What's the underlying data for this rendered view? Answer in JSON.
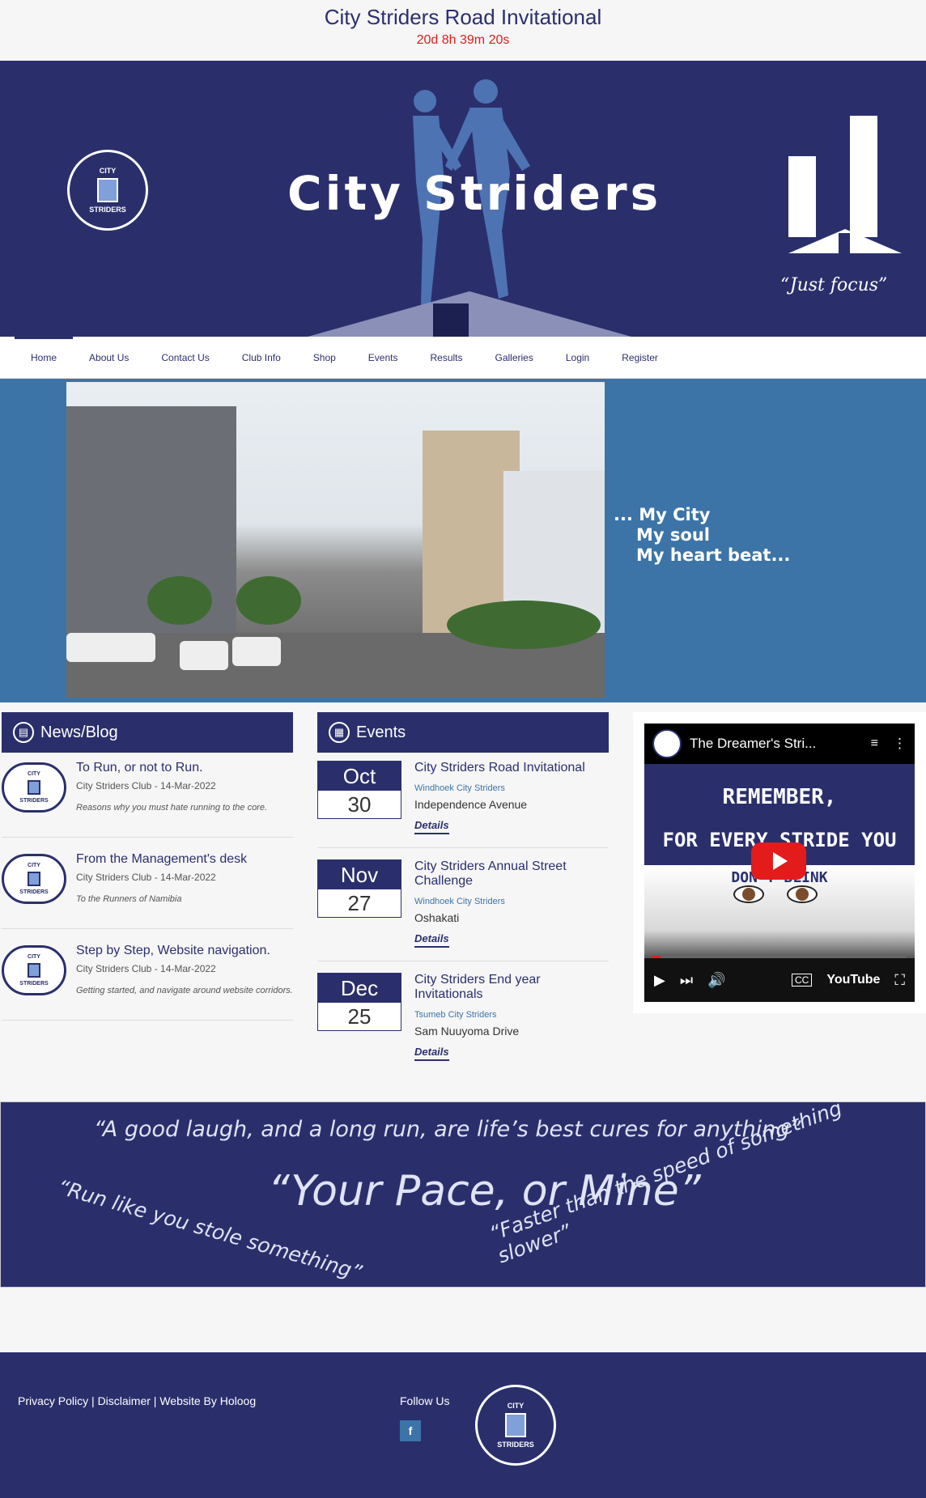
{
  "header": {
    "title": "City Striders Road Invitational",
    "countdown": "20d 8h 39m 20s"
  },
  "hero": {
    "brand": "City Striders",
    "logo_top": "CITY",
    "logo_bottom": "STRIDERS",
    "tagline": "“Just focus”"
  },
  "nav": {
    "items": [
      "Home",
      "About Us",
      "Contact Us",
      "Club Info",
      "Shop",
      "Events",
      "Results",
      "Galleries",
      "Login",
      "Register"
    ]
  },
  "banner": {
    "slogan": [
      "... My City",
      "My soul",
      "My heart beat..."
    ]
  },
  "news": {
    "heading": "News/Blog",
    "items": [
      {
        "title": "To Run, or not to Run.",
        "meta": "City Striders Club - 14-Mar-2022",
        "excerpt": "Reasons why you must hate running to the core."
      },
      {
        "title": "From the Management's desk",
        "meta": "City Striders Club - 14-Mar-2022",
        "excerpt": "To the Runners of Namibia"
      },
      {
        "title": "Step by Step, Website navigation.",
        "meta": "City Striders Club - 14-Mar-2022",
        "excerpt": "Getting started, and navigate around website corridors."
      }
    ]
  },
  "events": {
    "heading": "Events",
    "items": [
      {
        "month": "Oct",
        "day": "30",
        "title": "City Striders Road Invitational",
        "organizer": "Windhoek City Striders",
        "location": "Independence Avenue",
        "details": "Details"
      },
      {
        "month": "Nov",
        "day": "27",
        "title": "City Striders Annual Street Challenge",
        "organizer": "Windhoek City Striders",
        "location": "Oshakati",
        "details": "Details"
      },
      {
        "month": "Dec",
        "day": "25",
        "title": "City Striders End year Invitationals",
        "organizer": "Tsumeb City Striders",
        "location": "Sam Nuuyoma Drive",
        "details": "Details"
      }
    ]
  },
  "video": {
    "title": "The Dreamer's Stri...",
    "line1": "REMEMBER,",
    "line2": "FOR EVERY STRIDE YOU TAKE",
    "line3": "DON'T BLINK",
    "brand": "YouTube"
  },
  "quotes": {
    "q1": "“A good laugh, and a long run, are life’s best cures for anything”",
    "q2": "“Your Pace, or Mine”",
    "q3": "“Run like you stole something”",
    "q4": "“Faster than the speed of something slower”"
  },
  "footer": {
    "privacy": "Privacy Policy",
    "disclaimer": "Disclaimer",
    "by": "Website By Holoog",
    "sep": "|",
    "follow": "Follow Us",
    "fb": "f"
  }
}
